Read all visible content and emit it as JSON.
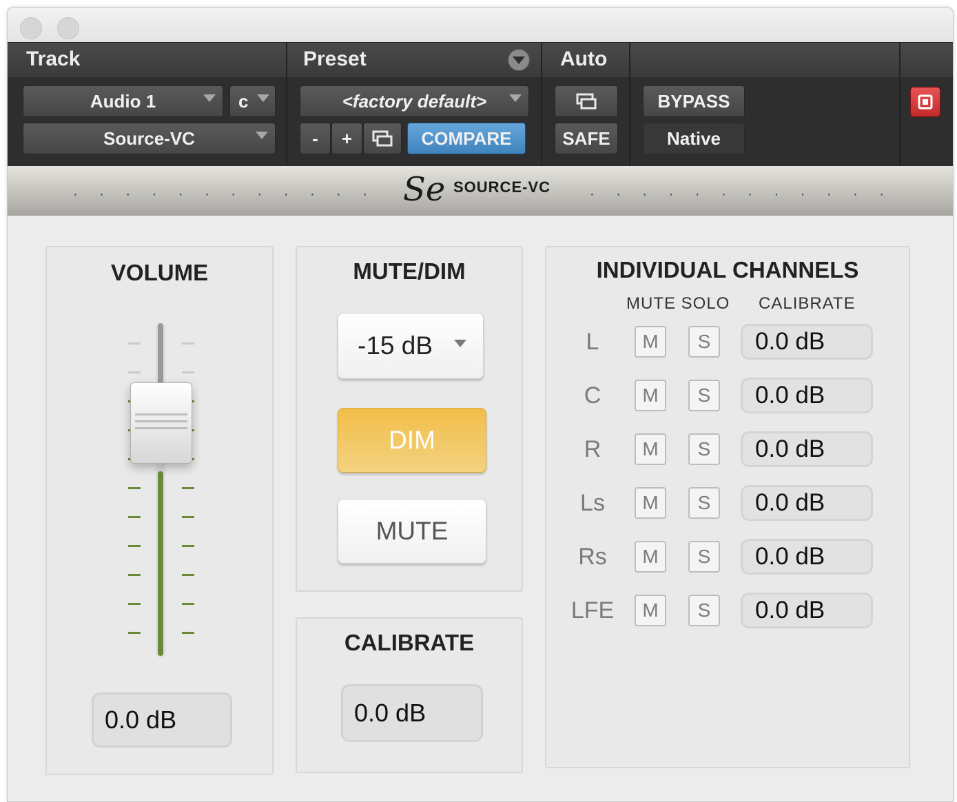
{
  "header": {
    "track_label": "Track",
    "preset_label": "Preset",
    "auto_label": "Auto",
    "track_name": "Audio 1",
    "channel": "c",
    "plugin_name": "Source-VC",
    "preset_name": "<factory default>",
    "minus": "-",
    "plus": "+",
    "compare": "COMPARE",
    "bypass": "BYPASS",
    "safe": "SAFE",
    "native": "Native"
  },
  "brand": {
    "logo": "Se",
    "name": "SOURCE-VC"
  },
  "volume": {
    "title": "VOLUME",
    "value": "0.0 dB"
  },
  "mutedim": {
    "title": "MUTE/DIM",
    "dim_level": "-15 dB",
    "dim": "DIM",
    "mute": "MUTE"
  },
  "calibrate": {
    "title": "CALIBRATE",
    "value": "0.0 dB"
  },
  "channels": {
    "title": "INDIVIDUAL CHANNELS",
    "col_mute_solo": "MUTE SOLO",
    "col_calibrate": "CALIBRATE",
    "rows": [
      {
        "label": "L",
        "mute": "M",
        "solo": "S",
        "value": "0.0 dB"
      },
      {
        "label": "C",
        "mute": "M",
        "solo": "S",
        "value": "0.0 dB"
      },
      {
        "label": "R",
        "mute": "M",
        "solo": "S",
        "value": "0.0 dB"
      },
      {
        "label": "Ls",
        "mute": "M",
        "solo": "S",
        "value": "0.0 dB"
      },
      {
        "label": "Rs",
        "mute": "M",
        "solo": "S",
        "value": "0.0 dB"
      },
      {
        "label": "LFE",
        "mute": "M",
        "solo": "S",
        "value": "0.0 dB"
      }
    ]
  },
  "colors": {
    "compare_blue": "#4f93c9",
    "dim_amber": "#f0c04e",
    "fader_green": "#6a8a3a",
    "power_red": "#d83a3a"
  }
}
